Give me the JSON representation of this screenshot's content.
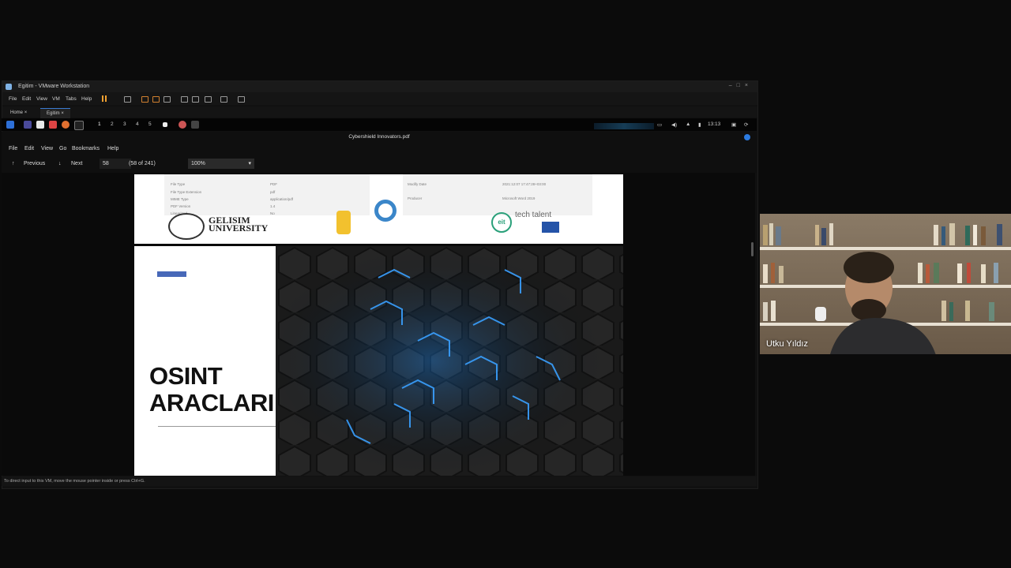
{
  "vmware": {
    "title": "Egitim - VMware Workstation",
    "menu": [
      "File",
      "Edit",
      "View",
      "VM",
      "Tabs",
      "Help"
    ],
    "tabs": [
      "Home",
      "Egitim"
    ]
  },
  "guest_taskbar": {
    "workspaces": [
      "1",
      "2",
      "3",
      "4",
      "5"
    ],
    "time": "13:13"
  },
  "pdf_viewer": {
    "window_title": "Cybershield Innovators.pdf",
    "menu": [
      "File",
      "Edit",
      "View",
      "Go",
      "Bookmarks",
      "Help"
    ],
    "previous_label": "Previous",
    "next_label": "Next",
    "page_value": "58",
    "page_of": "(58 of 241)",
    "zoom": "100%"
  },
  "page_top": {
    "meta_left": [
      "File Type",
      "File Type Extension",
      "MIME Type",
      "PDF Version",
      "Linearized"
    ],
    "meta_left_values": [
      "PDF",
      "pdf",
      "application/pdf",
      "1.4",
      "No"
    ],
    "meta_right": [
      "Modify Date",
      "Producer"
    ],
    "meta_right_values": [
      "2021:12:07 17:47:28+03:00",
      "Microsoft Word 2019"
    ],
    "logo1_text": "GELISIM\nUNIVERSITY",
    "logo3_text": "tech talent"
  },
  "page_slide": {
    "title_line1": "OSINT",
    "title_line2": "ARACLARI"
  },
  "status_text": "To direct input to this VM, move the mouse pointer inside or press Ctrl+G.",
  "webcam": {
    "participant": "Utku Yıldız"
  }
}
